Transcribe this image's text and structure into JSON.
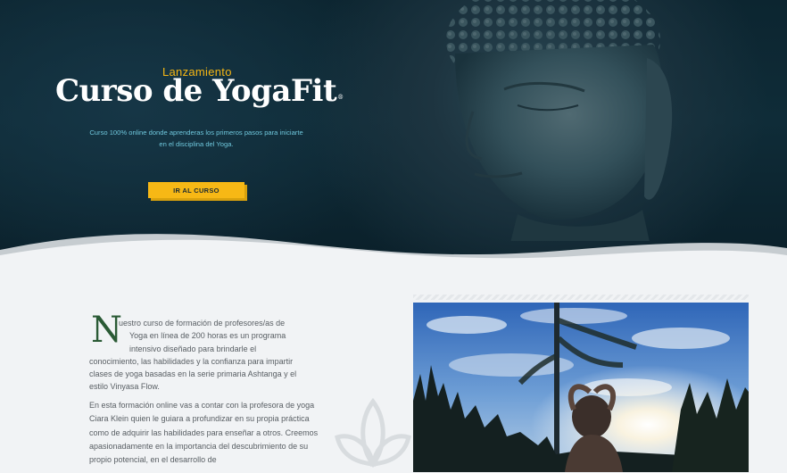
{
  "hero": {
    "eyebrow": "Lanzamiento",
    "title": "Curso de YogaFit",
    "trademark": "®",
    "subtitle": "Curso 100% online donde aprenderas los primeros pasos para iniciarte en el disciplina del Yoga.",
    "cta_label": "IR AL CURSO",
    "accent_color": "#f7b815",
    "background_color": "#0f2c38"
  },
  "about": {
    "dropcap": "N",
    "para1_lines": [
      "uestro curso de formación de profesores/as de",
      "Yoga en línea de 200 horas es un programa",
      "intensivo diseñado para brindarle el",
      "conocimiento, las habilidades y la confianza para impartir",
      "clases de yoga basadas en la serie primaria Ashtanga y el",
      "estilo Vinyasa Flow."
    ],
    "para2": "En esta formación online vas a contar con la profesora de yoga Ciara Klein quien le guiara a profundizar en su propia práctica como de adquirir las habilidades para enseñar a otros. Creemos apasionadamente en la importancia del descubrimiento de su propio potencial, en el desarrollo de",
    "dropcap_color": "#2a5a35"
  },
  "icons": {
    "hero_image": "buddha-statue",
    "decoration": "lotus-outline-icon",
    "photo": "yoga-meditation-forest-photo"
  }
}
